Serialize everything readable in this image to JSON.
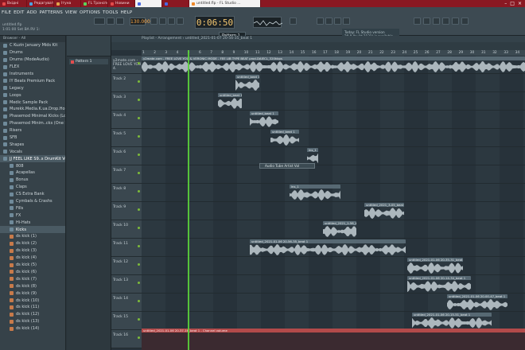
{
  "taskbar": {
    "tabs": [
      {
        "label": "Вхідні",
        "color": "#e24a4a",
        "active": false
      },
      {
        "label": "Редагувати ...",
        "color": "#4aa3e2",
        "active": false
      },
      {
        "label": "Ітуна",
        "color": "#e2a54a",
        "active": false
      },
      {
        "label": "FL Транспорт",
        "color": "#5ad35a",
        "active": false
      },
      {
        "label": "Новини",
        "color": "#e24a4a",
        "active": false
      },
      {
        "label": "",
        "color": "#4a6ae2",
        "active": true
      },
      {
        "label": "",
        "color": "#4a6ae2",
        "active": false
      },
      {
        "label": "untitled.flp - FL Studio ...",
        "color": "#ef8a2a",
        "active": true
      }
    ]
  },
  "menu": [
    "FILE",
    "EDIT",
    "ADD",
    "PATTERNS",
    "VIEW",
    "OPTIONS",
    "TOOLS",
    "HELP"
  ],
  "songinfo": {
    "line1": "untitled.flp",
    "line2": "1:01:00  Set BA RV 1:"
  },
  "transport": {
    "tempo": "130.000",
    "time": "0:06:50",
    "pattern": "Pattern 1"
  },
  "news": {
    "line1": "Today: FL Studio version",
    "line2": "20.8 (build 2131) is available"
  },
  "browser": {
    "header": "Browser - All",
    "items": [
      {
        "label": "C Kuzin January Mids Kit",
        "kind": "folder",
        "sel": false
      },
      {
        "label": "Drums",
        "kind": "folder",
        "sel": false
      },
      {
        "label": "Drums (ModeAudio)",
        "kind": "folder",
        "sel": false
      },
      {
        "label": "FLEX",
        "kind": "folder",
        "sel": false
      },
      {
        "label": "Instruments",
        "kind": "folder",
        "sel": false
      },
      {
        "label": "IY Beats Premium Pack",
        "kind": "folder",
        "sel": false
      },
      {
        "label": "Legacy",
        "kind": "folder",
        "sel": false
      },
      {
        "label": "Loops",
        "kind": "folder",
        "sel": false
      },
      {
        "label": "Medic Sample Pack",
        "kind": "folder",
        "sel": false
      },
      {
        "label": "Murekk.Media.K.ua.Drop.House",
        "kind": "folder",
        "sel": false
      },
      {
        "label": "Phasemod Minimal Kicks (Loops)",
        "kind": "folder",
        "sel": false
      },
      {
        "label": "Phasemod Minim..cks (One Shot)",
        "kind": "folder",
        "sel": false
      },
      {
        "label": "Risers",
        "kind": "folder",
        "sel": false
      },
      {
        "label": "SFB",
        "kind": "folder",
        "sel": false
      },
      {
        "label": "Shapes",
        "kind": "folder",
        "sel": false
      },
      {
        "label": "Vocals",
        "kind": "folder",
        "sel": false
      },
      {
        "label": "JJ FEEL LIKE S9..s DrumKit Vol.1",
        "kind": "folder",
        "sel": true
      },
      {
        "label": "808",
        "kind": "sub",
        "sel": false
      },
      {
        "label": "Acapellas",
        "kind": "sub",
        "sel": false
      },
      {
        "label": "Bonus",
        "kind": "sub",
        "sel": false
      },
      {
        "label": "Claps",
        "kind": "sub",
        "sel": false
      },
      {
        "label": "CS Extra Bank",
        "kind": "sub",
        "sel": false
      },
      {
        "label": "Cymbals & Crashs",
        "kind": "sub",
        "sel": false
      },
      {
        "label": "Fills",
        "kind": "sub",
        "sel": false
      },
      {
        "label": "FX",
        "kind": "sub",
        "sel": false
      },
      {
        "label": "Hi-Hats",
        "kind": "sub",
        "sel": false
      },
      {
        "label": "Kicks",
        "kind": "sub",
        "sel": true
      },
      {
        "label": "ds kick (1)",
        "kind": "file",
        "sel": false
      },
      {
        "label": "ds kick (2)",
        "kind": "file",
        "sel": false
      },
      {
        "label": "ds kick (3)",
        "kind": "file",
        "sel": false
      },
      {
        "label": "ds kick (4)",
        "kind": "file",
        "sel": false
      },
      {
        "label": "ds kick (5)",
        "kind": "file",
        "sel": false
      },
      {
        "label": "ds kick (6)",
        "kind": "file",
        "sel": false
      },
      {
        "label": "ds kick (7)",
        "kind": "file",
        "sel": false
      },
      {
        "label": "ds kick (8)",
        "kind": "file",
        "sel": false
      },
      {
        "label": "ds kick (9)",
        "kind": "file",
        "sel": false
      },
      {
        "label": "ds kick (10)",
        "kind": "file",
        "sel": false
      },
      {
        "label": "ds kick (11)",
        "kind": "file",
        "sel": false
      },
      {
        "label": "ds kick (12)",
        "kind": "file",
        "sel": false
      },
      {
        "label": "ds kick (13)",
        "kind": "file",
        "sel": false
      },
      {
        "label": "ds kick (14)",
        "kind": "file",
        "sel": false
      }
    ]
  },
  "patterns": {
    "items": [
      "Pattern 1"
    ]
  },
  "playlist": {
    "title": "Playlist - Arrangement › untitled_2021-01-07 20-56-35_beat 1",
    "ruler": [
      "1",
      "2",
      "3",
      "4",
      "5",
      "6",
      "7",
      "8",
      "9",
      "10",
      "11",
      "12",
      "13",
      "14",
      "15",
      "16",
      "17",
      "18",
      "19",
      "20",
      "21",
      "22",
      "23",
      "24",
      "25",
      "26",
      "27",
      "28",
      "29",
      "30",
      "31",
      "32",
      "33",
      "34"
    ],
    "automation_label": "Audio Tube Artist  Vol",
    "tracks": [
      {
        "name": "y2mate.com - FREE LOVE YOU 4.",
        "clips": [
          {
            "label": "y2mate.com - FREE LOVE YOU & VERONIC MODE - FEE LIB TYPE BEAT prod.DAIECL_320kbps",
            "start": 0,
            "len": 482
          }
        ]
      },
      {
        "name": "Track 2",
        "clips": [
          {
            "label": "untitled_beat 1",
            "start": 118,
            "len": 30
          }
        ]
      },
      {
        "name": "Track 3",
        "clips": [
          {
            "label": "untitled_beat 1",
            "start": 96,
            "len": 30
          }
        ]
      },
      {
        "name": "Track 4",
        "clips": [
          {
            "label": "untitled_beat 1",
            "start": 136,
            "len": 36
          }
        ]
      },
      {
        "name": "Track 5",
        "clips": [
          {
            "label": "untitled_beat 1",
            "start": 162,
            "len": 36
          }
        ]
      },
      {
        "name": "Track 6",
        "clips": [
          {
            "label": "ins_1",
            "start": 208,
            "len": 14
          }
        ]
      },
      {
        "name": "Track 7",
        "clips": []
      },
      {
        "name": "Track 8",
        "clips": [
          {
            "label": "ins_1",
            "start": 186,
            "len": 64
          }
        ]
      },
      {
        "name": "Track 9",
        "clips": [
          {
            "label": "untitled_2021_3-05_beat 1",
            "start": 280,
            "len": 50
          }
        ]
      },
      {
        "name": "Track 10",
        "clips": [
          {
            "label": "untitled_2021_1-56_beat 1",
            "start": 228,
            "len": 42
          }
        ]
      },
      {
        "name": "Track 11",
        "clips": [
          {
            "label": "untitled_2021-01-06 20-56-35_beat 1",
            "start": 136,
            "len": 196
          }
        ]
      },
      {
        "name": "Track 12",
        "clips": [
          {
            "label": "untitled_2021-01-06 20-35-31_beat 1",
            "start": 334,
            "len": 70
          }
        ]
      },
      {
        "name": "Track 13",
        "clips": [
          {
            "label": "untitled_2021-01-06 20-14-34_beat 1",
            "start": 334,
            "len": 80
          }
        ]
      },
      {
        "name": "Track 14",
        "clips": [
          {
            "label": "untitled_2021-01-06 20-00-47_beat 1",
            "start": 384,
            "len": 76
          }
        ]
      },
      {
        "name": "Track 15",
        "clips": [
          {
            "label": "untitled_2021-01-06 20-15-51_beat 1",
            "start": 340,
            "len": 100
          }
        ]
      },
      {
        "name": "Track 16",
        "clips": []
      }
    ],
    "bottom_label": "untitled_2021-01-06 20-37-16_beat 1 - Channel volume"
  },
  "colors": {
    "accent": "#f4c770",
    "taskbar": "#8a1822",
    "playhead": "#5bd33a"
  }
}
